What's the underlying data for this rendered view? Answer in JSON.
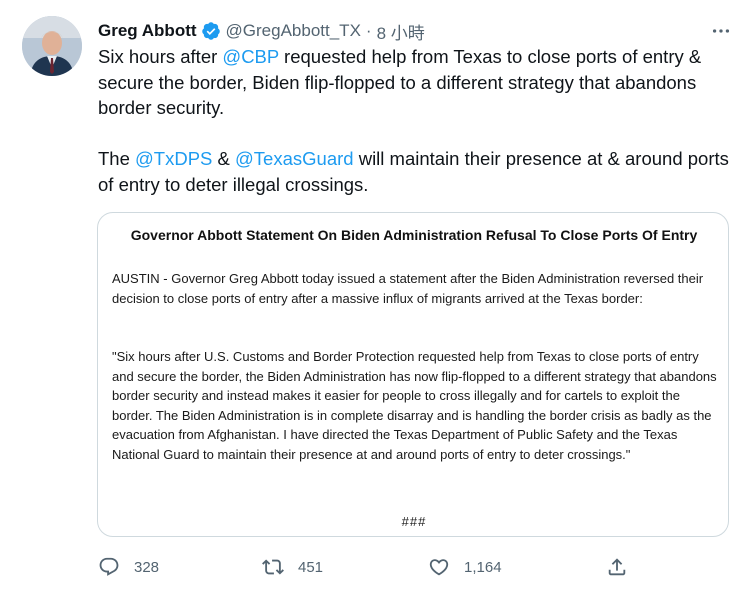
{
  "tweet": {
    "author": {
      "name": "Greg Abbott",
      "handle": "@GregAbbott_TX",
      "separator": "·",
      "timestamp": "8 小時"
    },
    "text": {
      "p1_before": "Six hours after ",
      "p1_mention": "@CBP",
      "p1_after": " requested help from Texas to close ports of entry & secure the border, Biden flip-flopped to a different strategy that abandons border security.",
      "p2_before": "The ",
      "p2_mention1": "@TxDPS",
      "p2_mid": " & ",
      "p2_mention2": "@TexasGuard",
      "p2_after": " will maintain their presence at & around ports of entry to deter illegal crossings."
    },
    "attachment": {
      "title": "Governor Abbott Statement On Biden Administration Refusal To Close Ports Of Entry",
      "paragraph1": "AUSTIN - Governor Greg Abbott today issued a statement after the Biden Administration reversed their decision to close ports of entry after a massive influx of migrants arrived at the Texas border:",
      "paragraph2": "\"Six hours after U.S. Customs and Border Protection requested help from Texas to close ports of entry and secure the border, the Biden Administration has now flip-flopped to a different strategy that abandons border security and instead makes it easier for people to cross illegally and for cartels to exploit the border. The Biden Administration is in complete disarray and is handling the border crisis as badly as the evacuation from Afghanistan. I have directed the Texas Department of Public Safety and the Texas National Guard to maintain their presence at and around ports of entry to deter crossings.\"",
      "footer": "###"
    },
    "actions": {
      "replies": "328",
      "retweets": "451",
      "likes": "1,164"
    }
  },
  "icons": {
    "verified": "verified-badge-icon",
    "more": "more-options-icon",
    "reply": "reply-icon",
    "retweet": "retweet-icon",
    "like": "heart-icon",
    "share": "share-icon"
  },
  "colors": {
    "accent": "#1d9bf0",
    "text": "#0f1419",
    "secondary": "#536471",
    "border": "#cfd9de"
  }
}
